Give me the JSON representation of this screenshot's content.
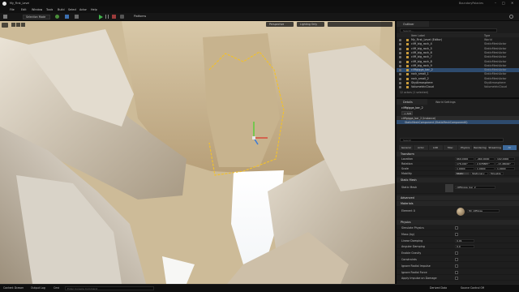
{
  "window": {
    "title": "My_First_Level",
    "project": "BoundaryPolacies",
    "controls": [
      "–",
      "□",
      "✕"
    ]
  },
  "menu": [
    "File",
    "Edit",
    "Window",
    "Tools",
    "Build",
    "Select",
    "Actor",
    "Help"
  ],
  "toolbar": {
    "mode": "Selection Mode",
    "platforms": "Platforms"
  },
  "viewport": {
    "view_mode_perspective": "Perspective",
    "view_mode_lit": "Lighting Only"
  },
  "outliner": {
    "tab": "Outliner",
    "tab2": "World Partition",
    "col_label": "Item Label",
    "col_type": "Type",
    "search_placeholder": "Search...",
    "summary": "12 actors (1 selected)",
    "rows": [
      {
        "name": "My_First_Level (Editor)",
        "type": "World"
      },
      {
        "name": "cliff_big_rock_4",
        "type": "StaticMeshActor"
      },
      {
        "name": "cliff_big_rock_5",
        "type": "StaticMeshActor"
      },
      {
        "name": "cliff_big_rock_6",
        "type": "StaticMeshActor"
      },
      {
        "name": "cliff_big_rock_7",
        "type": "StaticMeshActor"
      },
      {
        "name": "cliff_big_rock_8",
        "type": "StaticMeshActor"
      },
      {
        "name": "cliff_big_rock_9",
        "type": "StaticMeshActor"
      },
      {
        "name": "cliffgigga_bar_2",
        "type": "StaticMeshActor"
      },
      {
        "name": "rock_small_1",
        "type": "StaticMeshActor"
      },
      {
        "name": "rock_small_2",
        "type": "StaticMeshActor"
      },
      {
        "name": "SkyAtmosphere",
        "type": "SkyAtmosphere"
      },
      {
        "name": "VolumetricCloud",
        "type": "VolumetricCloud"
      }
    ],
    "selected_index": 7
  },
  "details": {
    "tab": "Details",
    "tab2": "World Settings",
    "actor": "cliffgigga_bar_2",
    "add_button": "+ Add",
    "component_root": "cliffgigga_bar_2 (Instance)",
    "component_mesh": "StaticMeshComponent (StaticMeshComponent0)",
    "search_placeholder": "Search",
    "filter_tabs": [
      "General",
      "Actor",
      "LOD",
      "Misc",
      "Physics",
      "Rendering",
      "Streaming",
      "All"
    ],
    "sections": {
      "transform": "Transform",
      "static_mesh": "Static Mesh",
      "advanced": "Advanced",
      "materials": "Materials",
      "physics": "Physics",
      "collision": "Collision"
    },
    "transform": {
      "location_label": "Location",
      "rotation_label": "Rotation",
      "scale_label": "Scale",
      "mobility_label": "Mobility",
      "location": [
        "660.0000",
        "-460.0000",
        "102.0000"
      ],
      "rotation": [
        "176.000°",
        "2.678887°",
        "-13.48000°"
      ],
      "scale": [
        "1.0000",
        "1.0000",
        "1.0000"
      ],
      "mobility": [
        "Static",
        "Stationary",
        "Movable"
      ]
    },
    "static_mesh": {
      "label": "Static Mesh",
      "value": "cliffgigga_bar_2"
    },
    "materials": {
      "label": "Element 0",
      "value": "MI_cliffgiga"
    },
    "physics": {
      "rows": [
        "Simulate Physics",
        "Mass (kg)",
        "Linear Damping",
        "Angular Damping",
        "Enable Gravity",
        "Constraints",
        "Ignore Radial Impulse",
        "Ignore Radial Force",
        "Apply Impulse on Damage"
      ],
      "values": [
        "",
        "",
        "0.01",
        "0.0",
        "",
        "",
        "",
        "",
        ""
      ]
    }
  },
  "statusbar": {
    "content_drawer": "Content Drawer",
    "output_log": "Output Log",
    "cmd": "Cmd",
    "console_placeholder": "Enter Console Command",
    "derived": "Derived Data",
    "source": "Source Control Off"
  },
  "colors": {
    "selection": "#2e4b6e",
    "panel": "#1e1e1e",
    "udemy": "#a435f0"
  }
}
